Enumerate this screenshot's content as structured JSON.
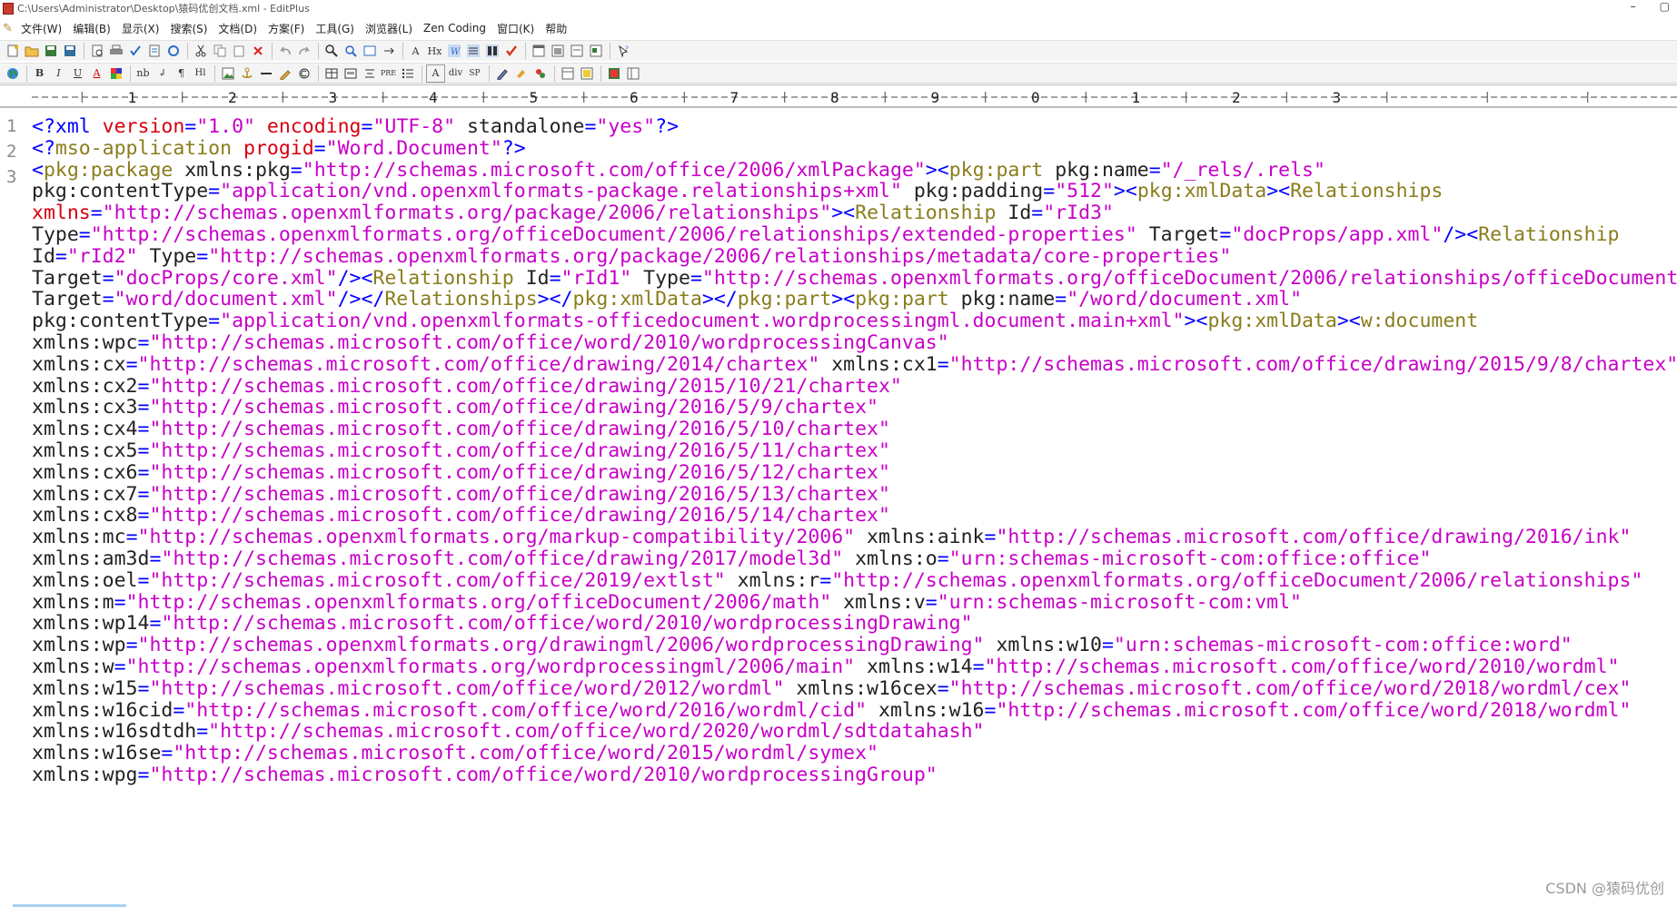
{
  "window": {
    "title": "C:\\Users\\Administrator\\Desktop\\猿码优创文档.xml - EditPlus",
    "minimize": "–",
    "restore": "▢"
  },
  "menu": [
    "文件(W)",
    "编辑(B)",
    "显示(X)",
    "搜索(S)",
    "文档(D)",
    "方案(F)",
    "工具(G)",
    "浏览器(L)",
    "Zen Coding",
    "窗口(K)",
    "帮助"
  ],
  "toolbar2_labels": {
    "bold": "B",
    "italic": "I",
    "underline": "U",
    "font_color": "A",
    "nb": "nb",
    "br": "↲",
    "para": "¶",
    "heading": "Hl",
    "pre": "PRE",
    "format": "A",
    "div": "div",
    "sp": "SP"
  },
  "ruler_numbers": [
    "1",
    "2",
    "3",
    "4",
    "5",
    "6",
    "7",
    "8",
    "9",
    "0",
    "1",
    "2",
    "3"
  ],
  "line_numbers": [
    "1",
    "2",
    "3"
  ],
  "code_lines": [
    [
      {
        "t": "<?",
        "c": "c-punct"
      },
      {
        "t": "xml ",
        "c": "c-tag"
      },
      {
        "t": "version",
        "c": "c-attr-red"
      },
      {
        "t": "=",
        "c": "c-eq"
      },
      {
        "t": "\"1.0\"",
        "c": "c-val"
      },
      {
        "t": " ",
        "c": "c-name"
      },
      {
        "t": "encoding",
        "c": "c-attr-red"
      },
      {
        "t": "=",
        "c": "c-eq"
      },
      {
        "t": "\"UTF-8\"",
        "c": "c-val"
      },
      {
        "t": " standalone",
        "c": "c-name"
      },
      {
        "t": "=",
        "c": "c-eq"
      },
      {
        "t": "\"yes\"",
        "c": "c-val"
      },
      {
        "t": "?>",
        "c": "c-punct"
      }
    ],
    [
      {
        "t": "<?",
        "c": "c-punct"
      },
      {
        "t": "mso-application ",
        "c": "c-elem"
      },
      {
        "t": "progid",
        "c": "c-attr-red"
      },
      {
        "t": "=",
        "c": "c-eq"
      },
      {
        "t": "\"Word.Document\"",
        "c": "c-val"
      },
      {
        "t": "?>",
        "c": "c-punct"
      }
    ],
    [
      {
        "t": "<",
        "c": "c-punct"
      },
      {
        "t": "pkg:package ",
        "c": "c-elem"
      },
      {
        "t": "xmlns:pkg",
        "c": "c-name"
      },
      {
        "t": "=",
        "c": "c-eq"
      },
      {
        "t": "\"http://schemas.microsoft.com/office/2006/xmlPackage\"",
        "c": "c-val"
      },
      {
        "t": "><",
        "c": "c-punct"
      },
      {
        "t": "pkg:part ",
        "c": "c-elem"
      },
      {
        "t": "pkg:name",
        "c": "c-name"
      },
      {
        "t": "=",
        "c": "c-eq"
      },
      {
        "t": "\"/_rels/.rels\"",
        "c": "c-val"
      }
    ],
    [
      {
        "t": "pkg:contentType",
        "c": "c-name"
      },
      {
        "t": "=",
        "c": "c-eq"
      },
      {
        "t": "\"application/vnd.openxmlformats-package.relationships+xml\"",
        "c": "c-val"
      },
      {
        "t": " pkg:padding",
        "c": "c-name"
      },
      {
        "t": "=",
        "c": "c-eq"
      },
      {
        "t": "\"512\"",
        "c": "c-val"
      },
      {
        "t": "><",
        "c": "c-punct"
      },
      {
        "t": "pkg:xmlData",
        "c": "c-elem"
      },
      {
        "t": "><",
        "c": "c-punct"
      },
      {
        "t": "Relationships",
        "c": "c-elem"
      }
    ],
    [
      {
        "t": "xmlns",
        "c": "c-attr-red"
      },
      {
        "t": "=",
        "c": "c-eq"
      },
      {
        "t": "\"http://schemas.openxmlformats.org/package/2006/relationships\"",
        "c": "c-val"
      },
      {
        "t": "><",
        "c": "c-punct"
      },
      {
        "t": "Relationship ",
        "c": "c-elem"
      },
      {
        "t": "Id",
        "c": "c-name"
      },
      {
        "t": "=",
        "c": "c-eq"
      },
      {
        "t": "\"rId3\"",
        "c": "c-val"
      }
    ],
    [
      {
        "t": "Type",
        "c": "c-name"
      },
      {
        "t": "=",
        "c": "c-eq"
      },
      {
        "t": "\"http://schemas.openxmlformats.org/officeDocument/2006/relationships/extended-properties\"",
        "c": "c-val"
      },
      {
        "t": " Target",
        "c": "c-name"
      },
      {
        "t": "=",
        "c": "c-eq"
      },
      {
        "t": "\"docProps/app.xml\"",
        "c": "c-val"
      },
      {
        "t": "/><",
        "c": "c-punct"
      },
      {
        "t": "Relationship",
        "c": "c-elem"
      }
    ],
    [
      {
        "t": "Id",
        "c": "c-name"
      },
      {
        "t": "=",
        "c": "c-eq"
      },
      {
        "t": "\"rId2\"",
        "c": "c-val"
      },
      {
        "t": " Type",
        "c": "c-name"
      },
      {
        "t": "=",
        "c": "c-eq"
      },
      {
        "t": "\"http://schemas.openxmlformats.org/package/2006/relationships/metadata/core-properties\"",
        "c": "c-val"
      }
    ],
    [
      {
        "t": "Target",
        "c": "c-name"
      },
      {
        "t": "=",
        "c": "c-eq"
      },
      {
        "t": "\"docProps/core.xml\"",
        "c": "c-val"
      },
      {
        "t": "/><",
        "c": "c-punct"
      },
      {
        "t": "Relationship ",
        "c": "c-elem"
      },
      {
        "t": "Id",
        "c": "c-name"
      },
      {
        "t": "=",
        "c": "c-eq"
      },
      {
        "t": "\"rId1\"",
        "c": "c-val"
      },
      {
        "t": " Type",
        "c": "c-name"
      },
      {
        "t": "=",
        "c": "c-eq"
      },
      {
        "t": "\"http://schemas.openxmlformats.org/officeDocument/2006/relationships/officeDocument\"",
        "c": "c-val"
      }
    ],
    [
      {
        "t": "Target",
        "c": "c-name"
      },
      {
        "t": "=",
        "c": "c-eq"
      },
      {
        "t": "\"word/document.xml\"",
        "c": "c-val"
      },
      {
        "t": "/></",
        "c": "c-punct"
      },
      {
        "t": "Relationships",
        "c": "c-elem"
      },
      {
        "t": "></",
        "c": "c-punct"
      },
      {
        "t": "pkg:xmlData",
        "c": "c-elem"
      },
      {
        "t": "></",
        "c": "c-punct"
      },
      {
        "t": "pkg:part",
        "c": "c-elem"
      },
      {
        "t": "><",
        "c": "c-punct"
      },
      {
        "t": "pkg:part ",
        "c": "c-elem"
      },
      {
        "t": "pkg:name",
        "c": "c-name"
      },
      {
        "t": "=",
        "c": "c-eq"
      },
      {
        "t": "\"/word/document.xml\"",
        "c": "c-val"
      }
    ],
    [
      {
        "t": "pkg:contentType",
        "c": "c-name"
      },
      {
        "t": "=",
        "c": "c-eq"
      },
      {
        "t": "\"application/vnd.openxmlformats-officedocument.wordprocessingml.document.main+xml\"",
        "c": "c-val"
      },
      {
        "t": "><",
        "c": "c-punct"
      },
      {
        "t": "pkg:xmlData",
        "c": "c-elem"
      },
      {
        "t": "><",
        "c": "c-punct"
      },
      {
        "t": "w:document",
        "c": "c-elem"
      }
    ],
    [
      {
        "t": "xmlns:wpc",
        "c": "c-name"
      },
      {
        "t": "=",
        "c": "c-eq"
      },
      {
        "t": "\"http://schemas.microsoft.com/office/word/2010/wordprocessingCanvas\"",
        "c": "c-val"
      }
    ],
    [
      {
        "t": "xmlns:cx",
        "c": "c-name"
      },
      {
        "t": "=",
        "c": "c-eq"
      },
      {
        "t": "\"http://schemas.microsoft.com/office/drawing/2014/chartex\"",
        "c": "c-val"
      },
      {
        "t": " xmlns:cx1",
        "c": "c-name"
      },
      {
        "t": "=",
        "c": "c-eq"
      },
      {
        "t": "\"http://schemas.microsoft.com/office/drawing/2015/9/8/chartex\"",
        "c": "c-val"
      }
    ],
    [
      {
        "t": "xmlns:cx2",
        "c": "c-name"
      },
      {
        "t": "=",
        "c": "c-eq"
      },
      {
        "t": "\"http://schemas.microsoft.com/office/drawing/2015/10/21/chartex\"",
        "c": "c-val"
      }
    ],
    [
      {
        "t": "xmlns:cx3",
        "c": "c-name"
      },
      {
        "t": "=",
        "c": "c-eq"
      },
      {
        "t": "\"http://schemas.microsoft.com/office/drawing/2016/5/9/chartex\"",
        "c": "c-val"
      }
    ],
    [
      {
        "t": "xmlns:cx4",
        "c": "c-name"
      },
      {
        "t": "=",
        "c": "c-eq"
      },
      {
        "t": "\"http://schemas.microsoft.com/office/drawing/2016/5/10/chartex\"",
        "c": "c-val"
      }
    ],
    [
      {
        "t": "xmlns:cx5",
        "c": "c-name"
      },
      {
        "t": "=",
        "c": "c-eq"
      },
      {
        "t": "\"http://schemas.microsoft.com/office/drawing/2016/5/11/chartex\"",
        "c": "c-val"
      }
    ],
    [
      {
        "t": "xmlns:cx6",
        "c": "c-name"
      },
      {
        "t": "=",
        "c": "c-eq"
      },
      {
        "t": "\"http://schemas.microsoft.com/office/drawing/2016/5/12/chartex\"",
        "c": "c-val"
      }
    ],
    [
      {
        "t": "xmlns:cx7",
        "c": "c-name"
      },
      {
        "t": "=",
        "c": "c-eq"
      },
      {
        "t": "\"http://schemas.microsoft.com/office/drawing/2016/5/13/chartex\"",
        "c": "c-val"
      }
    ],
    [
      {
        "t": "xmlns:cx8",
        "c": "c-name"
      },
      {
        "t": "=",
        "c": "c-eq"
      },
      {
        "t": "\"http://schemas.microsoft.com/office/drawing/2016/5/14/chartex\"",
        "c": "c-val"
      }
    ],
    [
      {
        "t": "xmlns:mc",
        "c": "c-name"
      },
      {
        "t": "=",
        "c": "c-eq"
      },
      {
        "t": "\"http://schemas.openxmlformats.org/markup-compatibility/2006\"",
        "c": "c-val"
      },
      {
        "t": " xmlns:aink",
        "c": "c-name"
      },
      {
        "t": "=",
        "c": "c-eq"
      },
      {
        "t": "\"http://schemas.microsoft.com/office/drawing/2016/ink\"",
        "c": "c-val"
      }
    ],
    [
      {
        "t": "xmlns:am3d",
        "c": "c-name"
      },
      {
        "t": "=",
        "c": "c-eq"
      },
      {
        "t": "\"http://schemas.microsoft.com/office/drawing/2017/model3d\"",
        "c": "c-val"
      },
      {
        "t": " xmlns:o",
        "c": "c-name"
      },
      {
        "t": "=",
        "c": "c-eq"
      },
      {
        "t": "\"urn:schemas-microsoft-com:office:office\"",
        "c": "c-val"
      }
    ],
    [
      {
        "t": "xmlns:oel",
        "c": "c-name"
      },
      {
        "t": "=",
        "c": "c-eq"
      },
      {
        "t": "\"http://schemas.microsoft.com/office/2019/extlst\"",
        "c": "c-val"
      },
      {
        "t": " xmlns:r",
        "c": "c-name"
      },
      {
        "t": "=",
        "c": "c-eq"
      },
      {
        "t": "\"http://schemas.openxmlformats.org/officeDocument/2006/relationships\"",
        "c": "c-val"
      }
    ],
    [
      {
        "t": "xmlns:m",
        "c": "c-name"
      },
      {
        "t": "=",
        "c": "c-eq"
      },
      {
        "t": "\"http://schemas.openxmlformats.org/officeDocument/2006/math\"",
        "c": "c-val"
      },
      {
        "t": " xmlns:v",
        "c": "c-name"
      },
      {
        "t": "=",
        "c": "c-eq"
      },
      {
        "t": "\"urn:schemas-microsoft-com:vml\"",
        "c": "c-val"
      }
    ],
    [
      {
        "t": "xmlns:wp14",
        "c": "c-name"
      },
      {
        "t": "=",
        "c": "c-eq"
      },
      {
        "t": "\"http://schemas.microsoft.com/office/word/2010/wordprocessingDrawing\"",
        "c": "c-val"
      }
    ],
    [
      {
        "t": "xmlns:wp",
        "c": "c-name"
      },
      {
        "t": "=",
        "c": "c-eq"
      },
      {
        "t": "\"http://schemas.openxmlformats.org/drawingml/2006/wordprocessingDrawing\"",
        "c": "c-val"
      },
      {
        "t": " xmlns:w10",
        "c": "c-name"
      },
      {
        "t": "=",
        "c": "c-eq"
      },
      {
        "t": "\"urn:schemas-microsoft-com:office:word\"",
        "c": "c-val"
      }
    ],
    [
      {
        "t": "xmlns:w",
        "c": "c-name"
      },
      {
        "t": "=",
        "c": "c-eq"
      },
      {
        "t": "\"http://schemas.openxmlformats.org/wordprocessingml/2006/main\"",
        "c": "c-val"
      },
      {
        "t": " xmlns:w14",
        "c": "c-name"
      },
      {
        "t": "=",
        "c": "c-eq"
      },
      {
        "t": "\"http://schemas.microsoft.com/office/word/2010/wordml\"",
        "c": "c-val"
      }
    ],
    [
      {
        "t": "xmlns:w15",
        "c": "c-name"
      },
      {
        "t": "=",
        "c": "c-eq"
      },
      {
        "t": "\"http://schemas.microsoft.com/office/word/2012/wordml\"",
        "c": "c-val"
      },
      {
        "t": " xmlns:w16cex",
        "c": "c-name"
      },
      {
        "t": "=",
        "c": "c-eq"
      },
      {
        "t": "\"http://schemas.microsoft.com/office/word/2018/wordml/cex\"",
        "c": "c-val"
      }
    ],
    [
      {
        "t": "xmlns:w16cid",
        "c": "c-name"
      },
      {
        "t": "=",
        "c": "c-eq"
      },
      {
        "t": "\"http://schemas.microsoft.com/office/word/2016/wordml/cid\"",
        "c": "c-val"
      },
      {
        "t": " xmlns:w16",
        "c": "c-name"
      },
      {
        "t": "=",
        "c": "c-eq"
      },
      {
        "t": "\"http://schemas.microsoft.com/office/word/2018/wordml\"",
        "c": "c-val"
      }
    ],
    [
      {
        "t": "xmlns:w16sdtdh",
        "c": "c-name"
      },
      {
        "t": "=",
        "c": "c-eq"
      },
      {
        "t": "\"http://schemas.microsoft.com/office/word/2020/wordml/sdtdatahash\"",
        "c": "c-val"
      }
    ],
    [
      {
        "t": "xmlns:w16se",
        "c": "c-name"
      },
      {
        "t": "=",
        "c": "c-eq"
      },
      {
        "t": "\"http://schemas.microsoft.com/office/word/2015/wordml/symex\"",
        "c": "c-val"
      }
    ],
    [
      {
        "t": "xmlns:wpg",
        "c": "c-name"
      },
      {
        "t": "=",
        "c": "c-eq"
      },
      {
        "t": "\"http://schemas.microsoft.com/office/word/2010/wordprocessingGroup\"",
        "c": "c-val"
      }
    ]
  ],
  "watermark": "CSDN @猿码优创"
}
